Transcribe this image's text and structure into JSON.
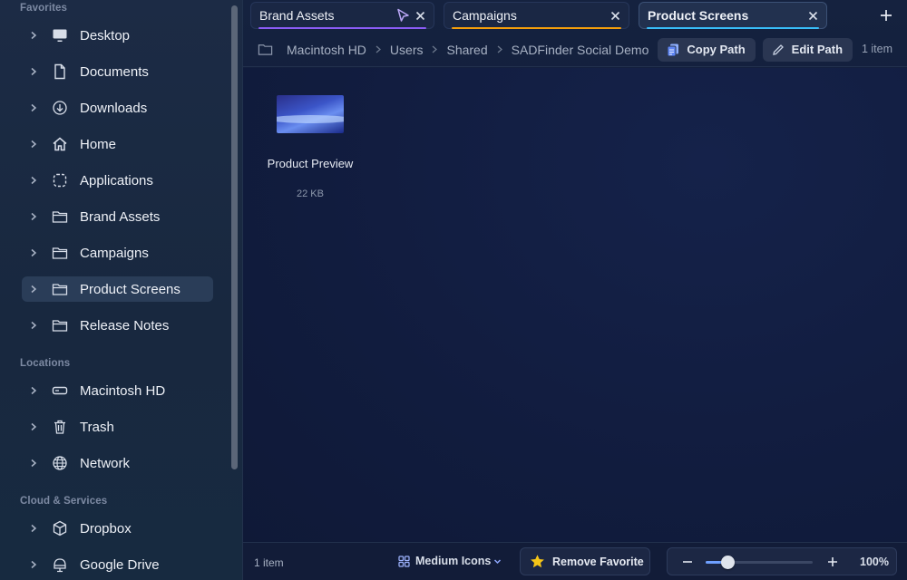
{
  "sidebar": {
    "sections": {
      "favorites": "Favorites",
      "locations": "Locations",
      "cloud": "Cloud & Services"
    },
    "favorites": [
      {
        "label": "Desktop",
        "icon": "desktop-icon"
      },
      {
        "label": "Documents",
        "icon": "document-icon"
      },
      {
        "label": "Downloads",
        "icon": "download-icon"
      },
      {
        "label": "Home",
        "icon": "home-icon"
      },
      {
        "label": "Applications",
        "icon": "applications-icon"
      },
      {
        "label": "Brand Assets",
        "icon": "folder-icon"
      },
      {
        "label": "Campaigns",
        "icon": "folder-icon"
      },
      {
        "label": "Product Screens",
        "icon": "folder-icon",
        "active": true
      },
      {
        "label": "Release Notes",
        "icon": "folder-icon"
      }
    ],
    "locations": [
      {
        "label": "Macintosh HD",
        "icon": "drive-icon"
      },
      {
        "label": "Trash",
        "icon": "trash-icon"
      },
      {
        "label": "Network",
        "icon": "globe-icon"
      }
    ],
    "cloud": [
      {
        "label": "Dropbox",
        "icon": "dropbox-icon"
      },
      {
        "label": "Google Drive",
        "icon": "cloud-drive-icon"
      }
    ]
  },
  "tabs": [
    {
      "label": "Brand Assets",
      "accent": "#8b5cf6"
    },
    {
      "label": "Campaigns",
      "accent": "#f59e0b"
    },
    {
      "label": "Product Screens",
      "accent": "#38bdf8",
      "active": true
    }
  ],
  "path": {
    "crumbs": [
      "Macintosh HD",
      "Users",
      "Shared",
      "SADFinder Social Demo"
    ],
    "copy_label": "Copy Path",
    "edit_label": "Edit Path",
    "item_count": "1 item"
  },
  "files": [
    {
      "name": "Product Preview",
      "size": "22 KB"
    }
  ],
  "status": {
    "item_count": "1 item",
    "view_label": "Medium Icons",
    "favorite_label": "Remove Favorite",
    "zoom_label": "100%",
    "zoom_fraction": 0.2
  },
  "colors": {
    "star": "#f5c518",
    "accent_blue": "#6fa0ff"
  }
}
